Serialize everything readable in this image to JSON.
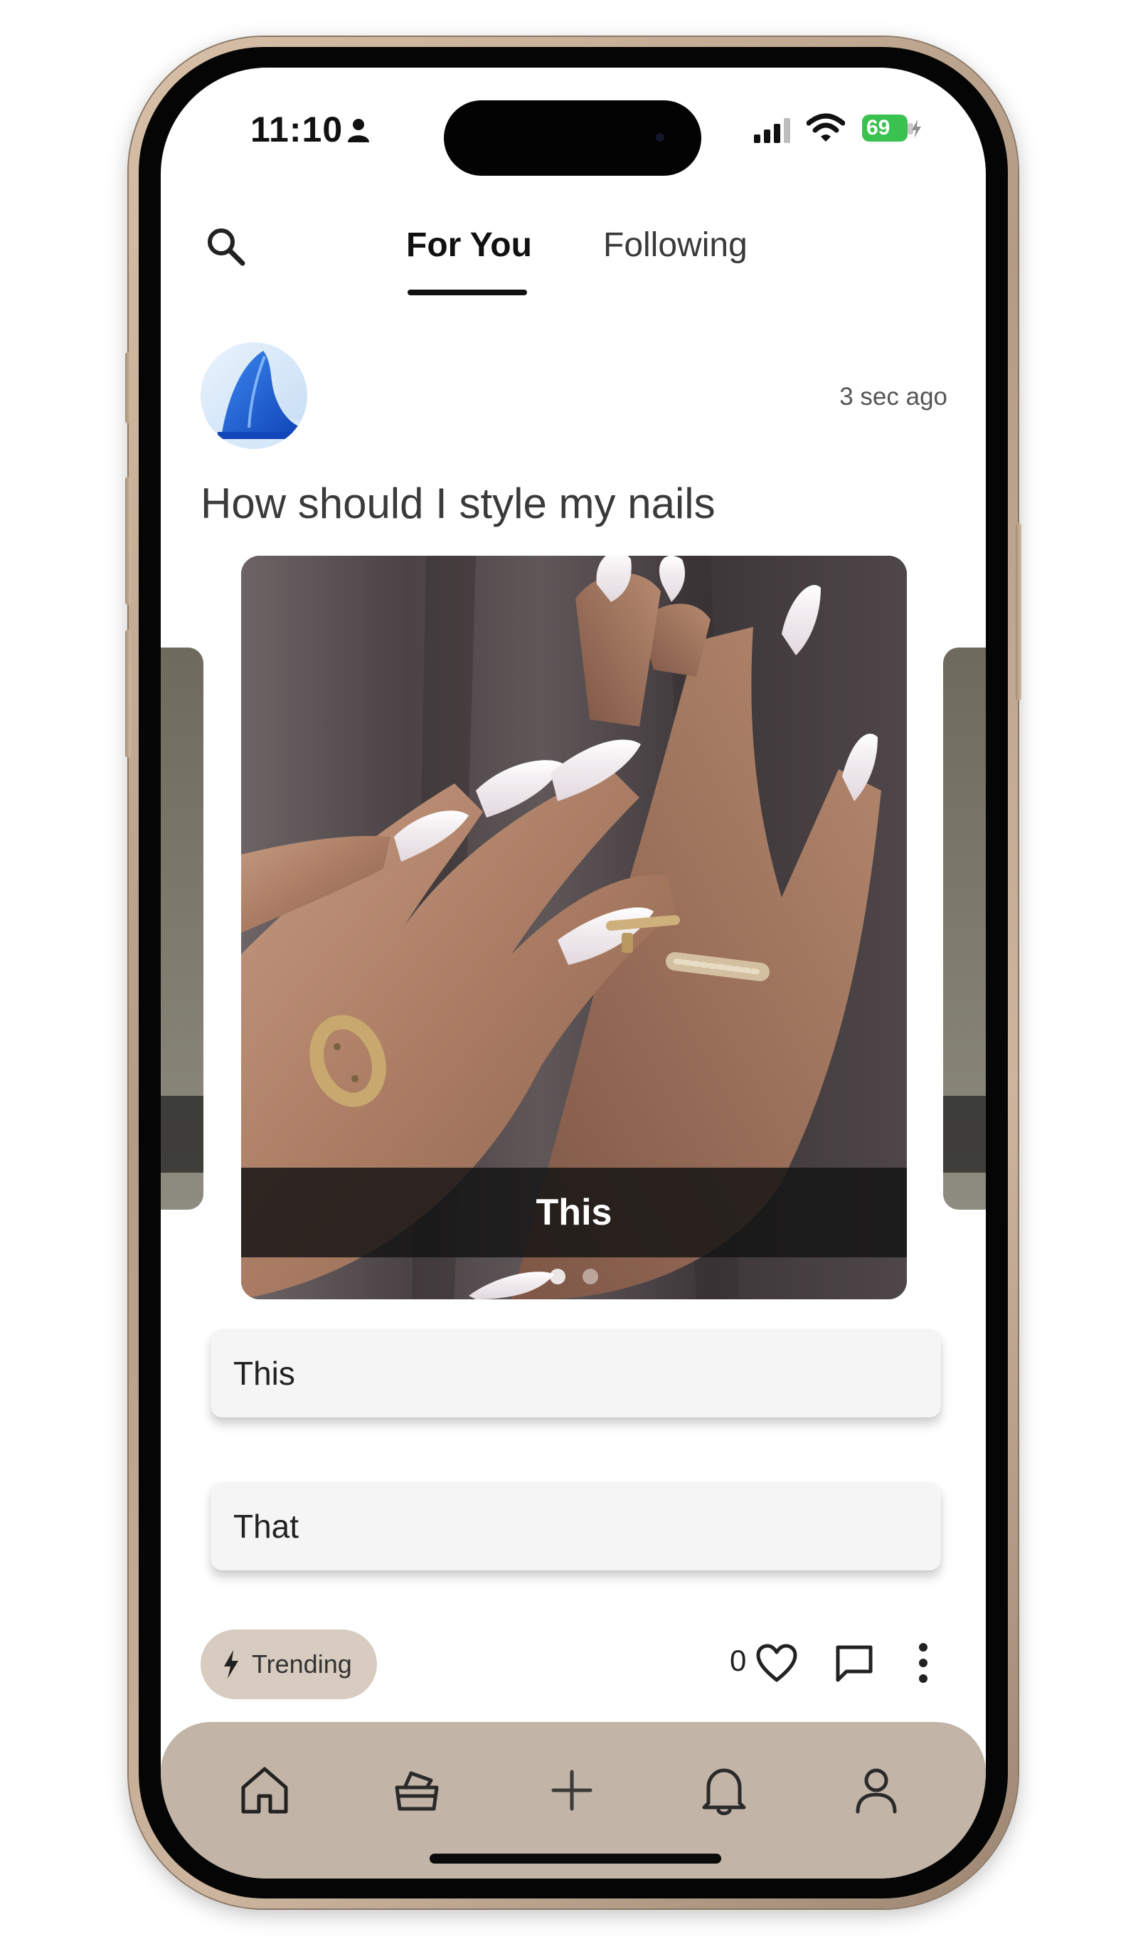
{
  "status_bar": {
    "time": "11:10",
    "battery": "69"
  },
  "nav": {
    "tabs": [
      {
        "label": "For You",
        "active": true
      },
      {
        "label": "Following",
        "active": false
      }
    ]
  },
  "post": {
    "time_ago": "3 sec ago",
    "title": "How should I style my nails",
    "carousel": {
      "caption": "This",
      "slide_count": 2,
      "active_slide": 1
    },
    "options": [
      {
        "label": "This"
      },
      {
        "label": "That"
      }
    ],
    "tag": "Trending",
    "like_count": "0"
  },
  "bottom_nav": {
    "items": [
      {
        "icon": "home-icon",
        "active": true
      },
      {
        "icon": "basket-icon",
        "active": false
      },
      {
        "icon": "plus-icon",
        "active": false
      },
      {
        "icon": "bell-icon",
        "active": false
      },
      {
        "icon": "person-icon",
        "active": false
      }
    ]
  },
  "colors": {
    "bottom_bar": "#c2b4a6",
    "trending_chip": "#d8cbc0",
    "battery": "#39c24f",
    "avatar_blue": "#1e5fd6"
  }
}
